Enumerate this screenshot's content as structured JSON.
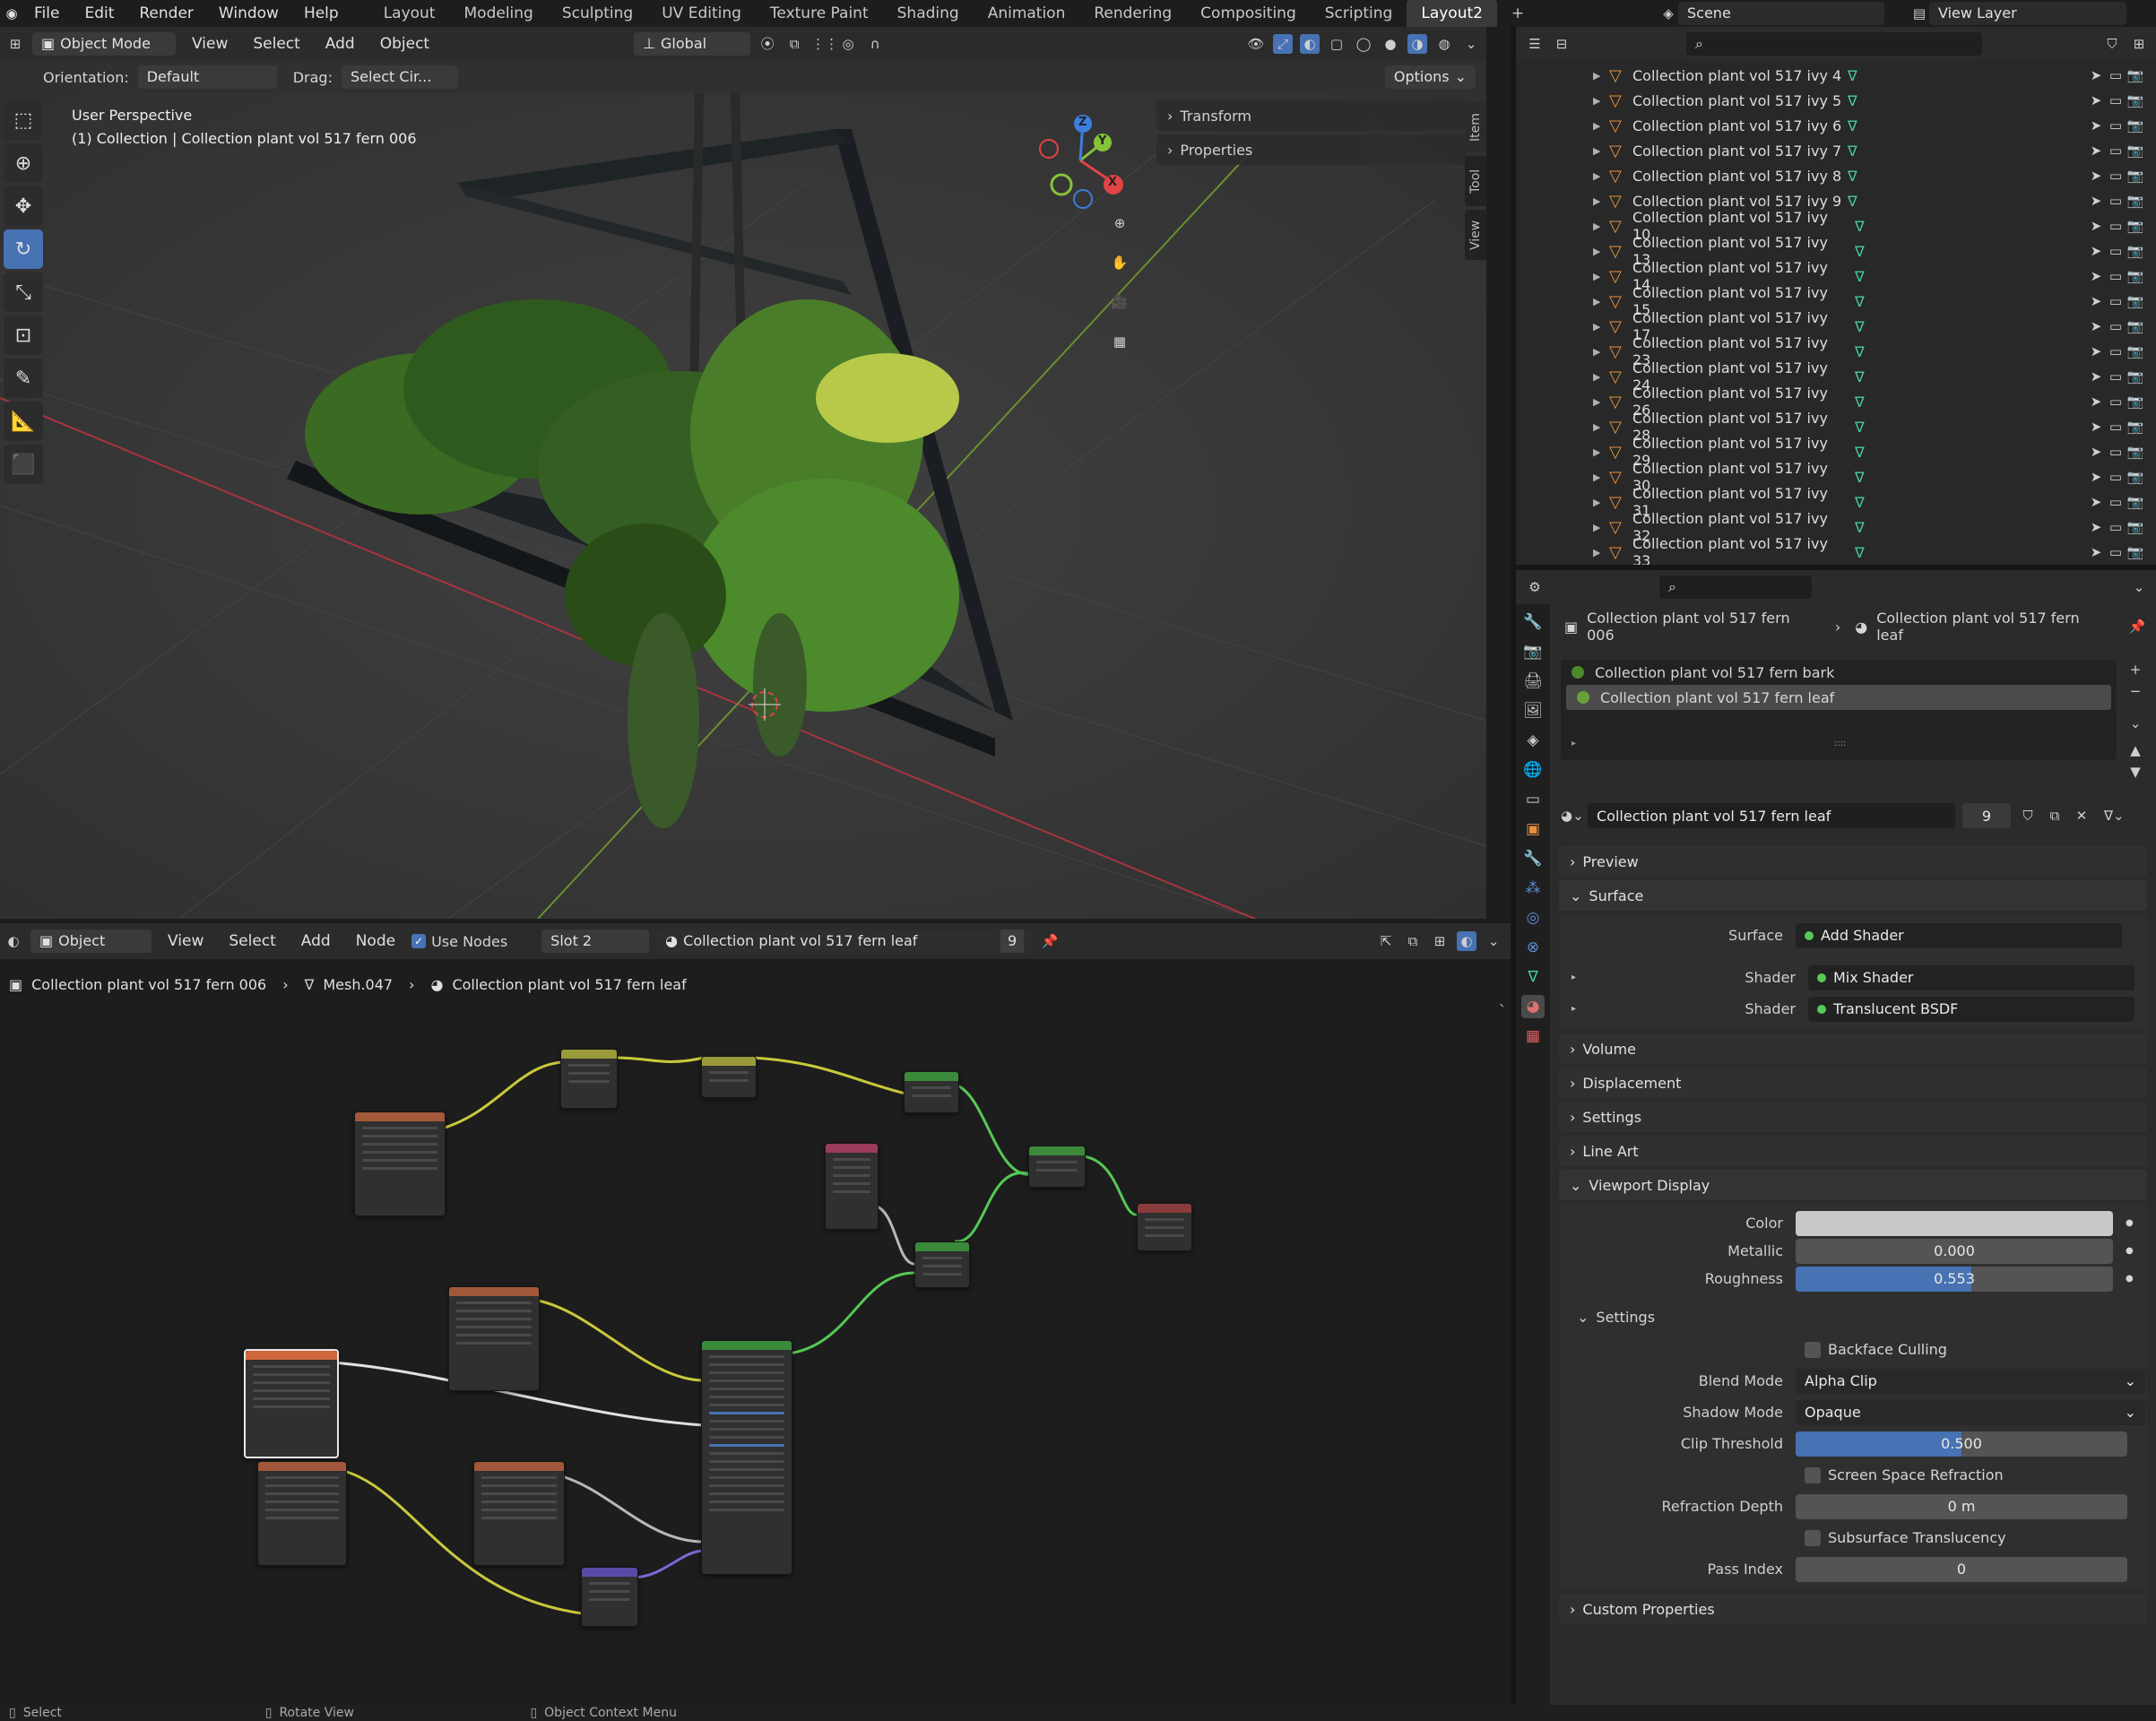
{
  "menubar": {
    "menus": [
      "File",
      "Edit",
      "Render",
      "Window",
      "Help"
    ],
    "workspaces": [
      "Layout",
      "Modeling",
      "Sculpting",
      "UV Editing",
      "Texture Paint",
      "Shading",
      "Animation",
      "Rendering",
      "Compositing",
      "Scripting",
      "Layout2"
    ],
    "active_workspace": "Layout2",
    "scene": "Scene",
    "view_layer": "View Layer"
  },
  "viewport": {
    "mode": "Object Mode",
    "menus": [
      "View",
      "Select",
      "Add",
      "Object"
    ],
    "transform_orientation": "Global",
    "orientation_label": "Orientation:",
    "orientation_value": "Default",
    "drag_label": "Drag:",
    "drag_value": "Select Cir...",
    "options": "Options",
    "info_line1": "User Perspective",
    "info_line2": "(1) Collection | Collection plant vol 517 fern 006",
    "npanel_sections": [
      "Transform",
      "Properties"
    ],
    "npanel_tabs": [
      "Item",
      "Tool",
      "View"
    ],
    "gizmo_axes": [
      "X",
      "Y",
      "Z"
    ]
  },
  "outliner": {
    "items": [
      "Collection plant vol 517 ivy 4",
      "Collection plant vol 517 ivy 5",
      "Collection plant vol 517 ivy 6",
      "Collection plant vol 517 ivy 7",
      "Collection plant vol 517 ivy 8",
      "Collection plant vol 517 ivy 9",
      "Collection plant vol 517 ivy 10",
      "Collection plant vol 517 ivy 13",
      "Collection plant vol 517 ivy 14",
      "Collection plant vol 517 ivy 15",
      "Collection plant vol 517 ivy 17",
      "Collection plant vol 517 ivy 23",
      "Collection plant vol 517 ivy 24",
      "Collection plant vol 517 ivy 26",
      "Collection plant vol 517 ivy 28",
      "Collection plant vol 517 ivy 29",
      "Collection plant vol 517 ivy 30",
      "Collection plant vol 517 ivy 31",
      "Collection plant vol 517 ivy 32",
      "Collection plant vol 517 ivy 33"
    ]
  },
  "properties": {
    "breadcrumb_object": "Collection plant vol 517 fern 006",
    "breadcrumb_material": "Collection plant vol 517 fern leaf",
    "slots": [
      "Collection plant vol 517 fern bark",
      "Collection plant vol 517 fern leaf"
    ],
    "material_name": "Collection plant vol 517 fern leaf",
    "material_users": "9",
    "sections": {
      "preview": "Preview",
      "surface": "Surface",
      "volume": "Volume",
      "displacement": "Displacement",
      "settings": "Settings",
      "line_art": "Line Art",
      "viewport_display": "Viewport Display",
      "custom_properties": "Custom Properties"
    },
    "surface_rows": [
      {
        "label": "Surface",
        "value": "Add Shader"
      },
      {
        "label": "Shader",
        "value": "Mix Shader"
      },
      {
        "label": "Shader",
        "value": "Translucent BSDF"
      }
    ],
    "viewport_display": {
      "color_label": "Color",
      "metallic_label": "Metallic",
      "metallic": "0.000",
      "roughness_label": "Roughness",
      "roughness": "0.553",
      "roughness_fraction": 0.553
    },
    "settings": {
      "title": "Settings",
      "backface_culling": "Backface Culling",
      "blend_mode_label": "Blend Mode",
      "blend_mode": "Alpha Clip",
      "shadow_mode_label": "Shadow Mode",
      "shadow_mode": "Opaque",
      "clip_threshold_label": "Clip Threshold",
      "clip_threshold": "0.500",
      "clip_threshold_fraction": 0.5,
      "screen_space_refraction": "Screen Space Refraction",
      "refraction_depth_label": "Refraction Depth",
      "refraction_depth": "0 m",
      "subsurface_translucency": "Subsurface Translucency",
      "pass_index_label": "Pass Index",
      "pass_index": "0"
    }
  },
  "node_editor": {
    "mode": "Object",
    "menus": [
      "View",
      "Select",
      "Add",
      "Node"
    ],
    "use_nodes": "Use Nodes",
    "slot": "Slot 2",
    "material_name": "Collection plant vol 517 fern leaf",
    "users": "9",
    "breadcrumb_object": "Collection plant vol 517 fern 006",
    "breadcrumb_mesh": "Mesh.047",
    "breadcrumb_material": "Collection plant vol 517 fern leaf"
  },
  "statusbar": {
    "items": [
      "Select",
      "Rotate View",
      "Object Context Menu"
    ]
  },
  "colors": {
    "accent": "#4772b3",
    "collection": "#e8913d",
    "mesh": "#49c9a4",
    "link_yellow": "#c9c93c",
    "link_green": "#55c955",
    "link_grey": "#b8b8b8",
    "link_purple": "#7a6ad8"
  }
}
